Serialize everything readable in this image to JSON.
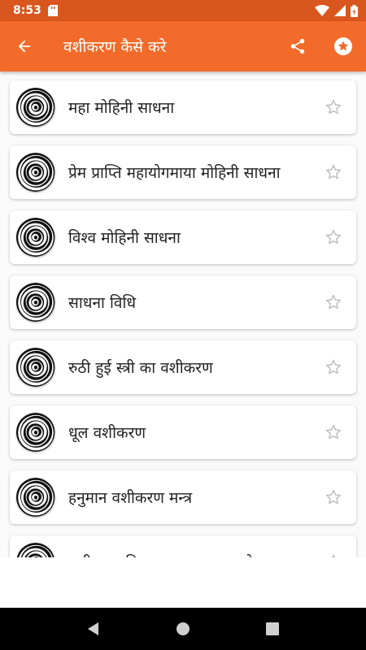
{
  "status_bar": {
    "time": "8:53"
  },
  "app_bar": {
    "title": "वशीकरण कैसे करे",
    "back_icon": "arrow-back-icon",
    "share_icon": "share-icon",
    "favorite_icon": "star-badge-icon",
    "color": "#f26b2a",
    "status_color": "#d9571e"
  },
  "items": [
    {
      "title": "महा मोहिनी साधना"
    },
    {
      "title": "प्रेम प्राप्ति महायोगमाया मोहिनी साधना"
    },
    {
      "title": "विश्व मोहिनी साधना"
    },
    {
      "title": "साधना विधि"
    },
    {
      "title": "रुठी हुई स्त्री का वशीकरण"
    },
    {
      "title": "धूल वशीकरण"
    },
    {
      "title": "हनुमान वशीकरण मन्त्र"
    },
    {
      "title": "वशीकरण तिलक का अनुभूत प्रयोग"
    }
  ],
  "nav_bar": {
    "back_icon": "nav-back-icon",
    "home_icon": "nav-home-icon",
    "recents_icon": "nav-recents-icon"
  }
}
